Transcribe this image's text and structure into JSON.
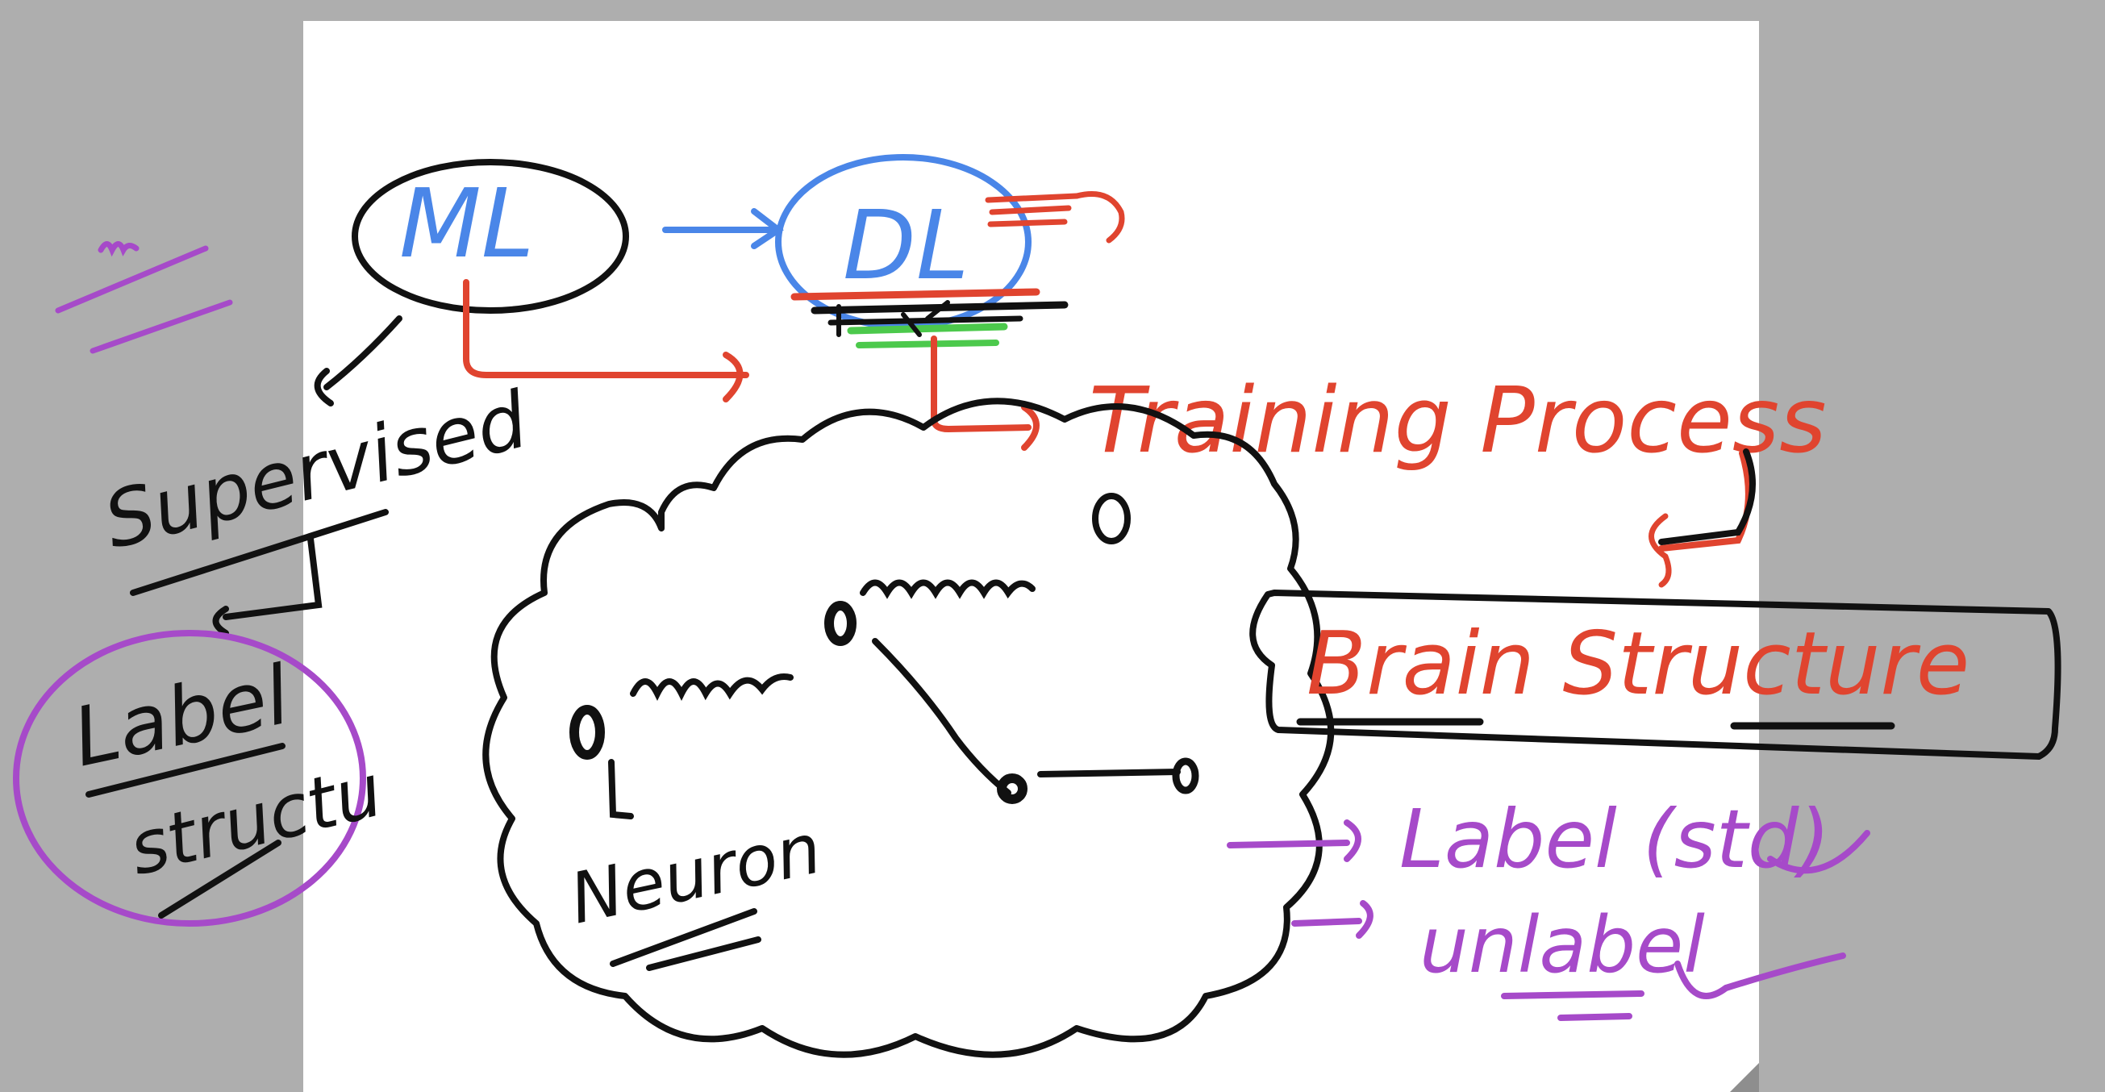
{
  "canvas": {
    "background": "#aeaeae",
    "page_color": "#ffffff"
  },
  "colors": {
    "blue": "#4a86e8",
    "red": "#e0442f",
    "black": "#111111",
    "purple": "#a64ac9",
    "green": "#4cc94c"
  },
  "nodes": {
    "ml": "ML",
    "dl": "DL",
    "supervised": "Supervised",
    "label_structure_1": "Label",
    "label_structure_2": "structu",
    "training_process": "Training Process",
    "brain_structure": "Brain Structure",
    "neuron": "Neuron",
    "label_std": "Label (std)",
    "unlabel": "unlabel",
    "margin_mark": "m"
  }
}
